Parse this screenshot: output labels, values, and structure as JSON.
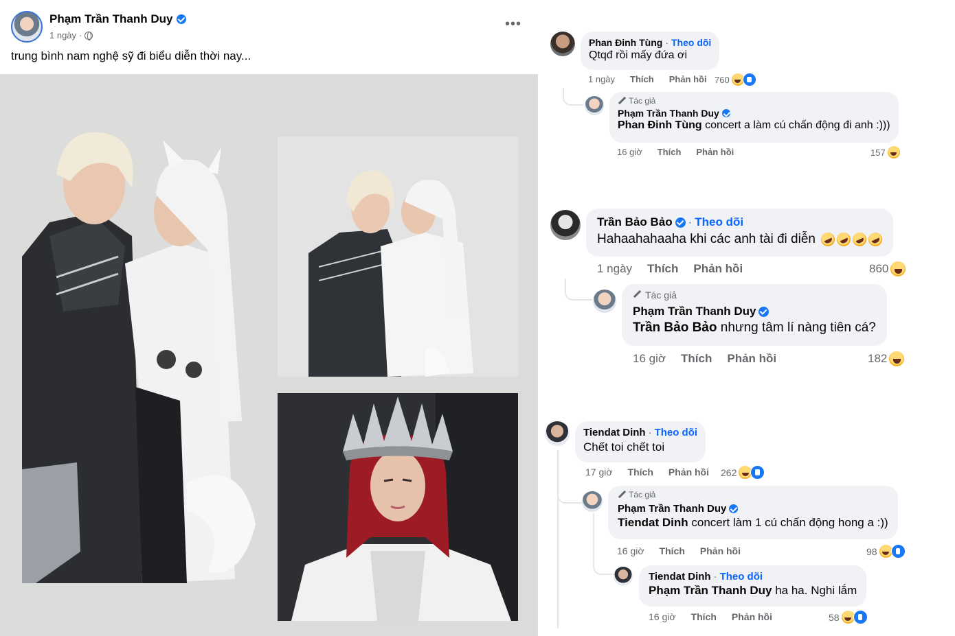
{
  "post": {
    "author": "Phạm Trần Thanh Duy",
    "time": "1 ngày",
    "caption": "trung bình nam nghệ sỹ đi biểu diễn thời nay..."
  },
  "comments": [
    {
      "name": "Phan Đinh Tùng",
      "follow": "Theo dõi",
      "text": "Qtqđ rồi mấy đứa ơi",
      "time": "1 ngày",
      "like": "Thích",
      "reply": "Phản hồi",
      "count": "760",
      "reply_item": {
        "tag": "Tác giả",
        "name": "Phạm Trần Thanh Duy",
        "mention": "Phan Đinh Tùng",
        "text": " concert a làm cú chấn động đi anh :)))",
        "time": "16 giờ",
        "like": "Thích",
        "reply": "Phản hồi",
        "count": "157"
      }
    },
    {
      "name": "Trần Bảo Bảo",
      "follow": "Theo dõi",
      "text": "Hahaahahaaha khi các anh tài đi diễn",
      "time": "1 ngày",
      "like": "Thích",
      "reply": "Phản hồi",
      "count": "860",
      "reply_item": {
        "tag": "Tác giả",
        "name": "Phạm Trần Thanh Duy",
        "mention": "Trần Bảo Bảo",
        "text": " nhưng tâm lí nàng tiên cá?",
        "time": "16 giờ",
        "like": "Thích",
        "reply": "Phản hồi",
        "count": "182"
      }
    },
    {
      "name": "Tiendat Dinh",
      "follow": "Theo dõi",
      "text": "Chết toi chết toi",
      "time": "17 giờ",
      "like": "Thích",
      "reply": "Phản hồi",
      "count": "262",
      "reply_item": {
        "tag": "Tác giả",
        "name": "Phạm Trần Thanh Duy",
        "mention": "Tiendat Dinh",
        "text": " concert làm 1 cú chấn động hong a :))",
        "time": "16 giờ",
        "like": "Thích",
        "reply": "Phản hồi",
        "count": "98"
      },
      "reply_item2": {
        "name": "Tiendat Dinh",
        "follow": "Theo dõi",
        "mention": "Phạm Trần Thanh Duy",
        "text": " ha ha. Nghi lắm",
        "time": "16 giờ",
        "like": "Thích",
        "reply": "Phản hồi",
        "count": "58"
      }
    }
  ],
  "colors": {
    "accent": "#0866ff",
    "bubble": "#f0f2f5",
    "muted": "#65676b",
    "verified": "#1877f2"
  },
  "icons": [
    "verified-icon",
    "globe-icon",
    "more-options-icon",
    "pen-icon",
    "haha-reaction-icon",
    "like-reaction-icon",
    "rofl-emoji-icon"
  ]
}
